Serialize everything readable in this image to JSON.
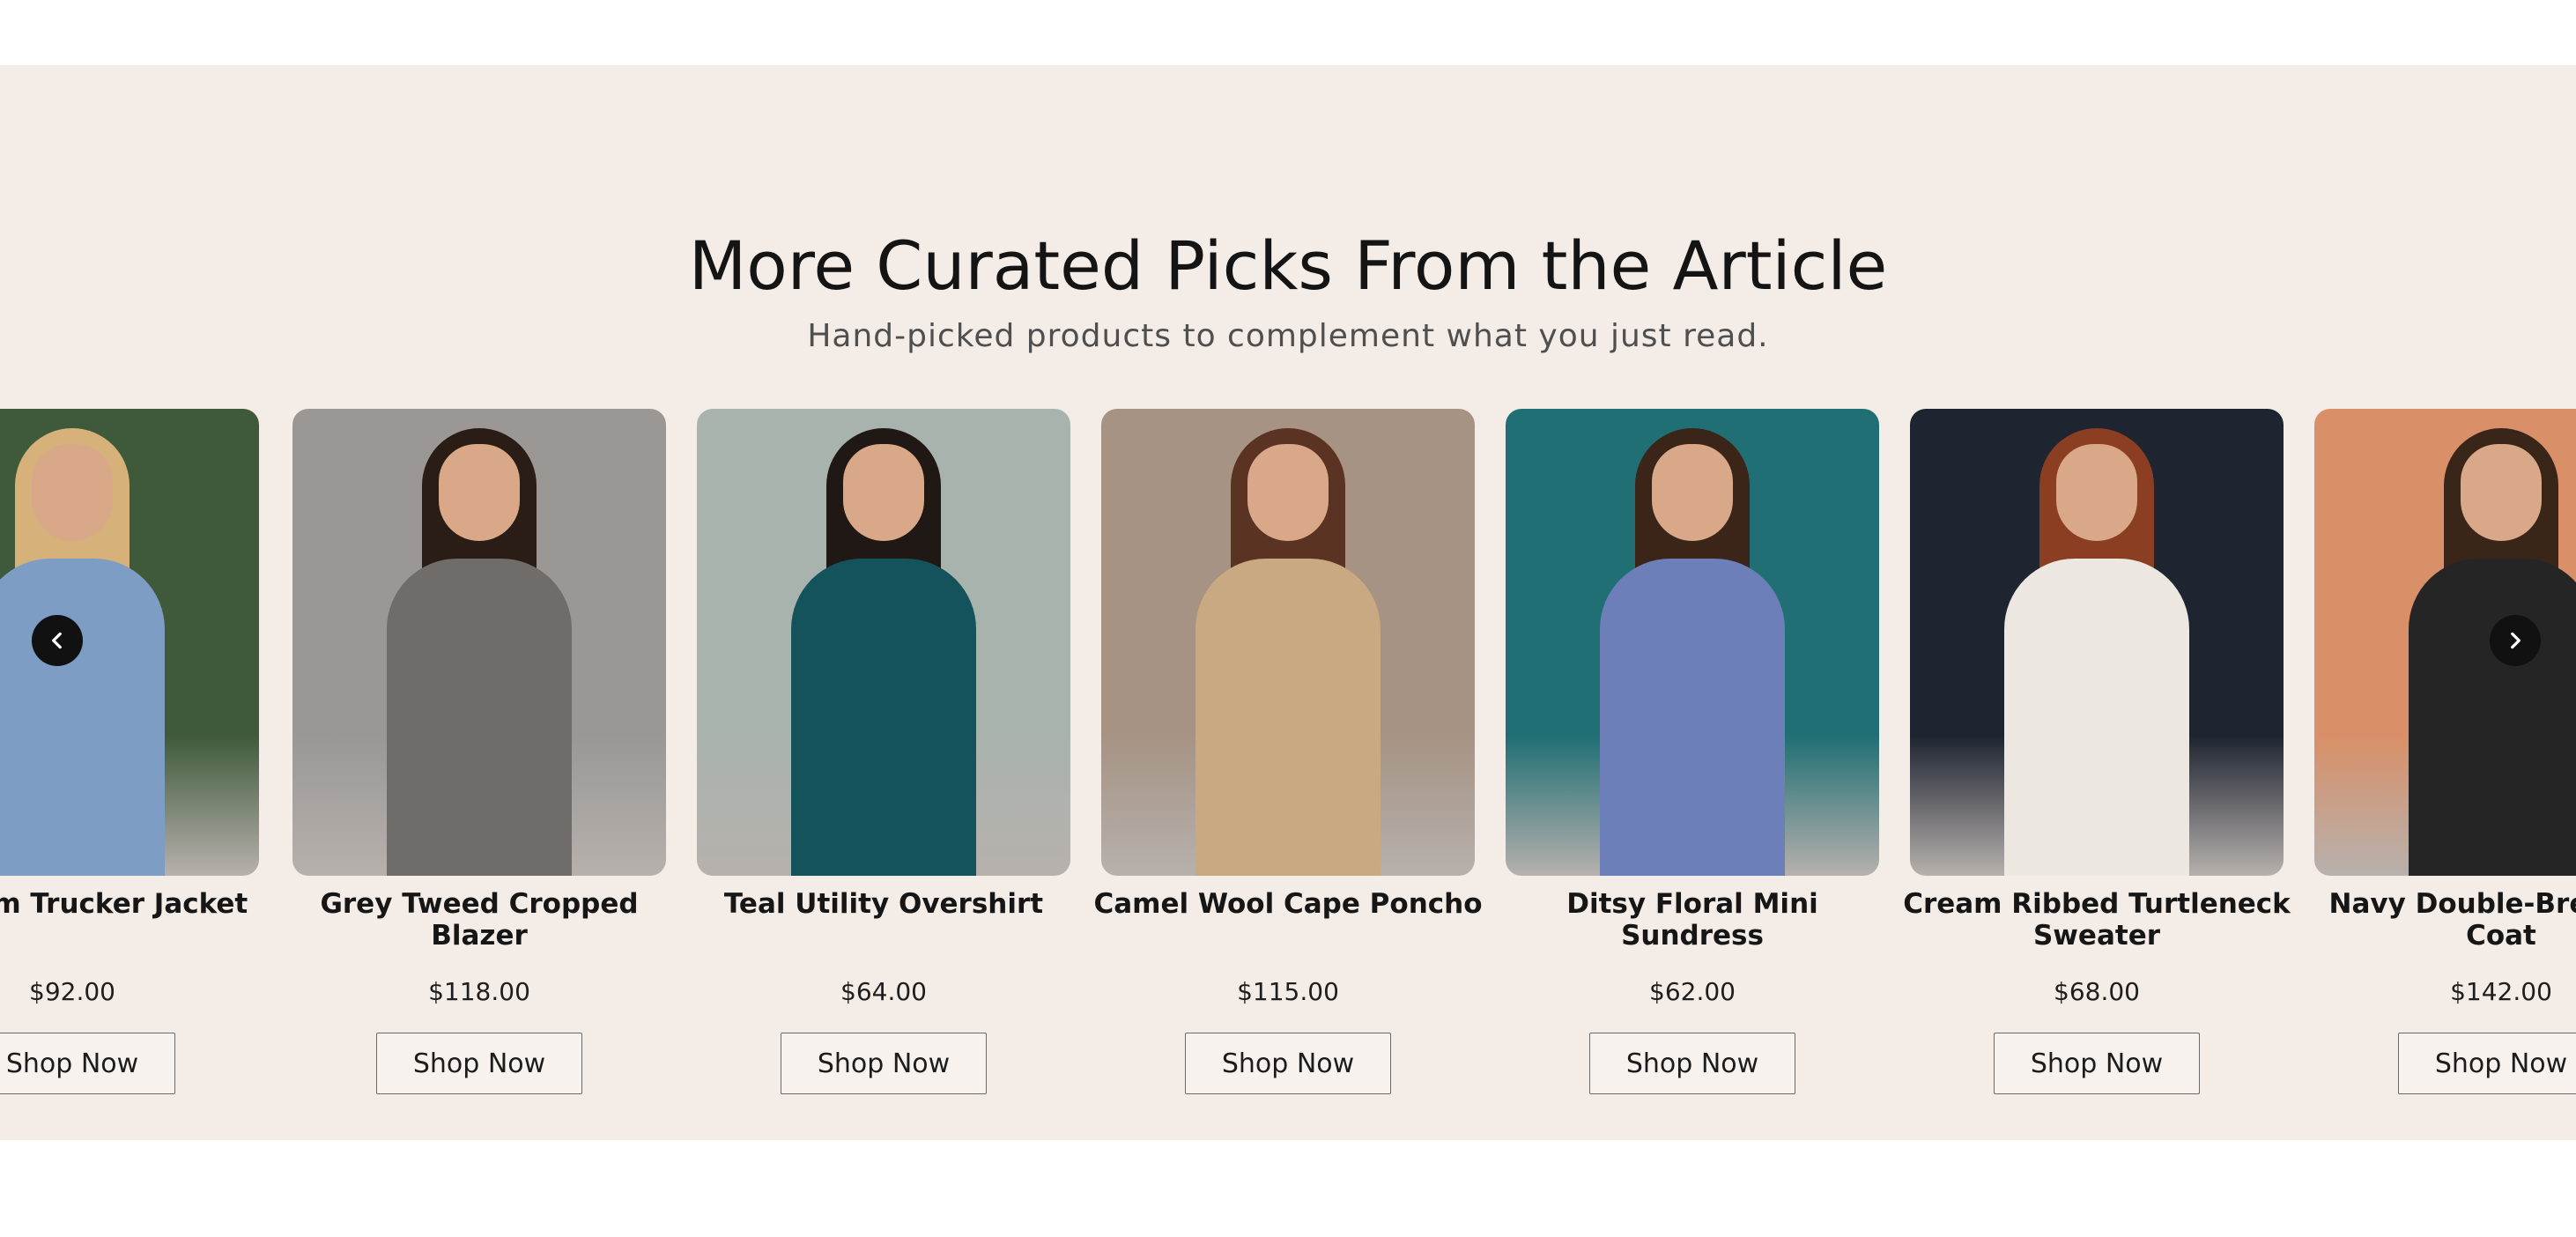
{
  "section": {
    "title": "More Curated Picks From the Article",
    "subtitle": "Hand-picked products to complement what you just read.",
    "background": "#f4ece7"
  },
  "carousel": {
    "prev_icon": "chevron-left-icon",
    "next_icon": "chevron-right-icon",
    "products": [
      {
        "title": "c Denim Trucker Jacket",
        "price": "$92.00",
        "button": "Shop Now",
        "image_bg": "#3f5a3a",
        "image_accent": "#7d9dc4",
        "hair": "#d6b27a"
      },
      {
        "title": "Grey Tweed Cropped Blazer",
        "price": "$118.00",
        "button": "Shop Now",
        "image_bg": "#9a9794",
        "image_accent": "#6f6c69",
        "hair": "#2a1d16"
      },
      {
        "title": "Teal Utility Overshirt",
        "price": "$64.00",
        "button": "Shop Now",
        "image_bg": "#a9b3ad",
        "image_accent": "#14535c",
        "hair": "#201814"
      },
      {
        "title": "Camel Wool Cape Poncho",
        "price": "$115.00",
        "button": "Shop Now",
        "image_bg": "#a69384",
        "image_accent": "#c9a982",
        "hair": "#5b3322"
      },
      {
        "title": "Ditsy Floral Mini Sundress",
        "price": "$62.00",
        "button": "Shop Now",
        "image_bg": "#1f6f74",
        "image_accent": "#6c7fb8",
        "hair": "#3a2518"
      },
      {
        "title": "Cream Ribbed Turtleneck Sweater",
        "price": "$68.00",
        "button": "Shop Now",
        "image_bg": "#1e2430",
        "image_accent": "#ece7e0",
        "hair": "#8b3e22"
      },
      {
        "title": "Navy Double-Bre Wool Coat",
        "price": "$142.00",
        "button": "Shop Now",
        "image_bg": "#d99068",
        "image_accent": "#252526",
        "hair": "#3a2619"
      }
    ]
  }
}
